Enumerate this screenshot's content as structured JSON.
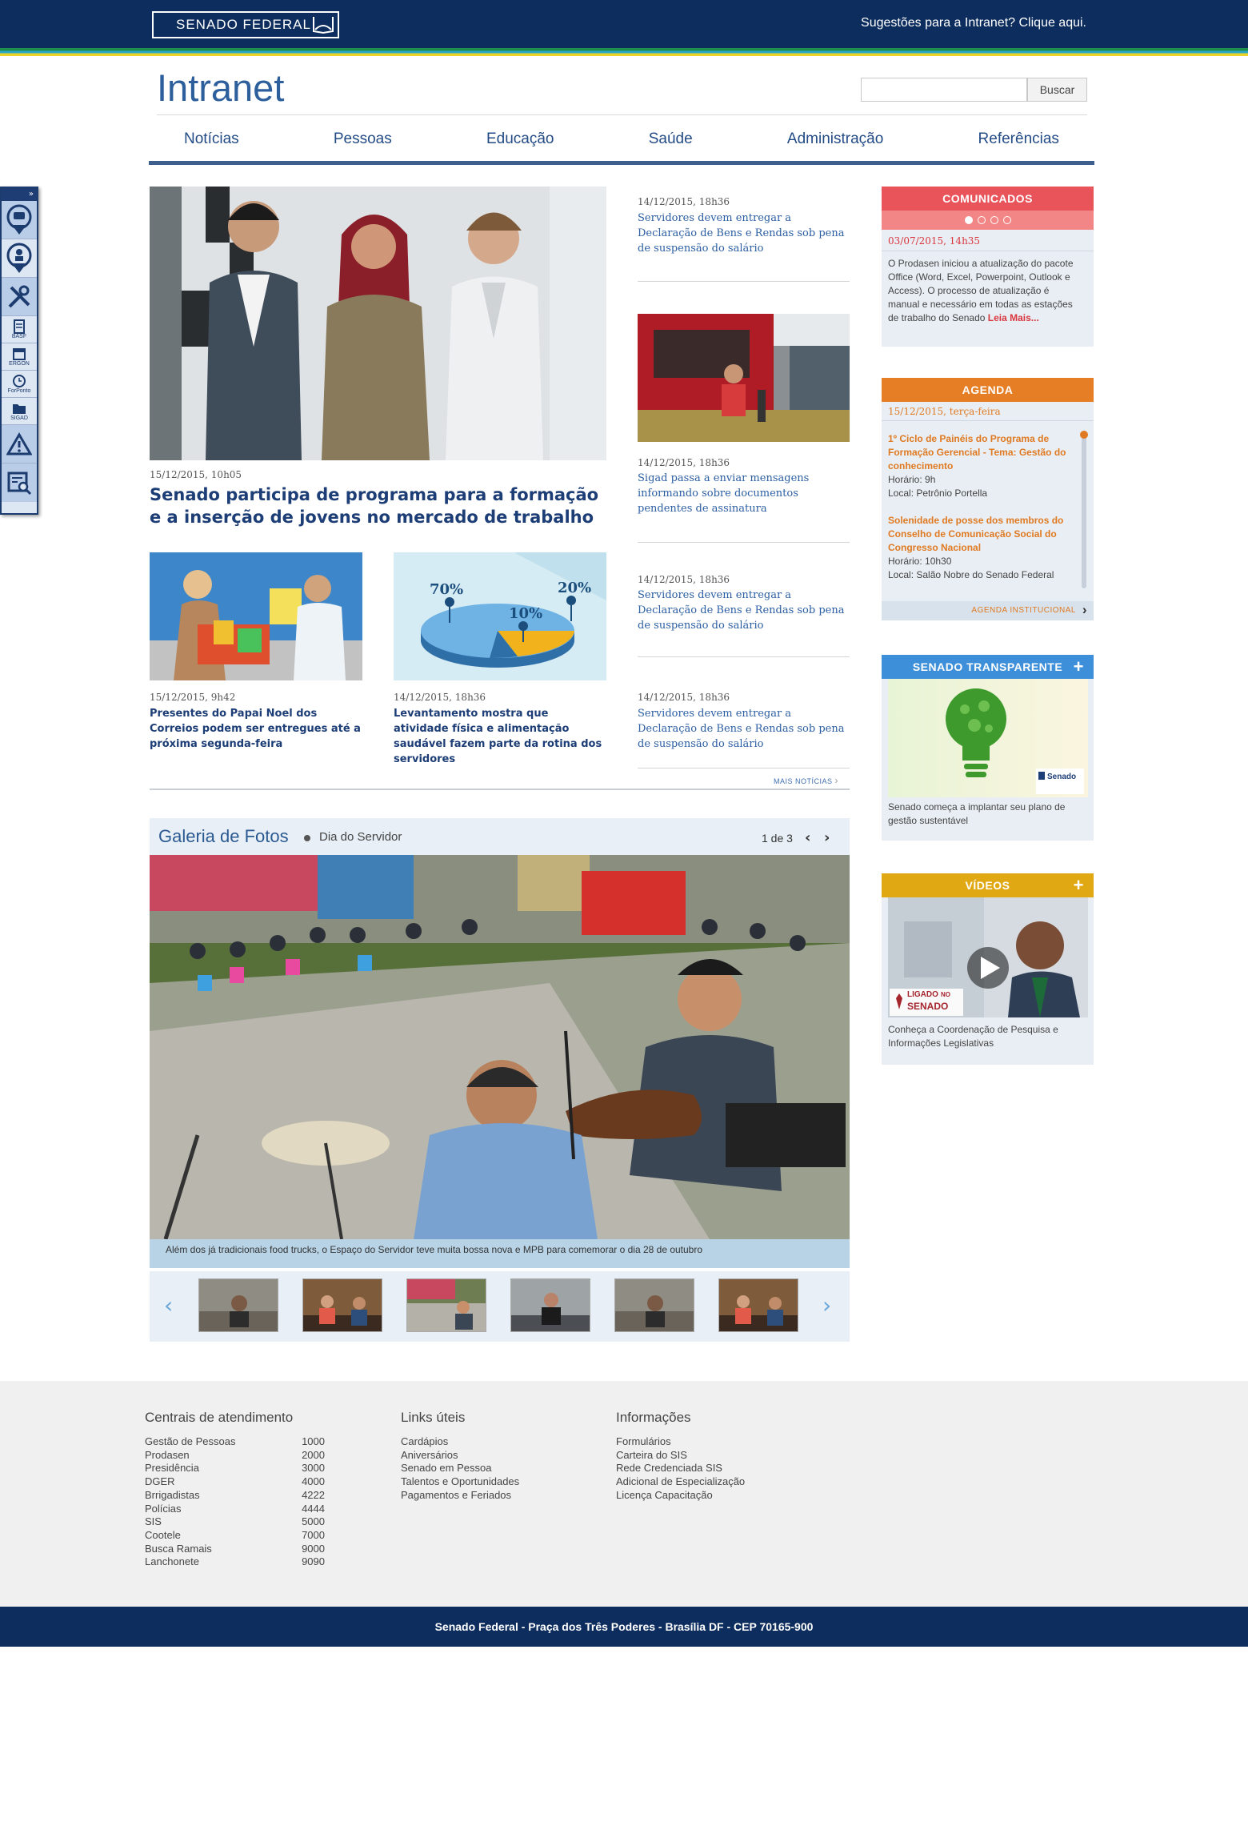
{
  "topbar": {
    "logo_text": "SENADO FEDERAL",
    "suggestion_link": "Sugestões para a Intranet? Clique aqui."
  },
  "header": {
    "title": "Intranet",
    "search_placeholder": "",
    "search_button": "Buscar"
  },
  "nav": [
    "Notícias",
    "Pessoas",
    "Educação",
    "Saúde",
    "Administração",
    "Referências"
  ],
  "tools": {
    "labels": [
      "BASF",
      "ERGON",
      "ForPonto",
      "SIGAD"
    ]
  },
  "featured": {
    "date": "15/12/2015, 10h05",
    "title": "Senado participa de programa para a formação e a inserção de jovens no mercado de trabalho"
  },
  "news_grid": [
    {
      "date": "15/12/2015, 9h42",
      "title": "Presentes do Papai Noel dos Correios podem ser entregues até a próxima segunda-feira"
    },
    {
      "date": "14/12/2015, 18h36",
      "title": "Levantamento mostra que atividade física e alimentação saudável fazem parte da rotina dos servidores"
    }
  ],
  "chart_labels": [
    "70%",
    "10%",
    "20%"
  ],
  "side_news": [
    {
      "date": "14/12/2015, 18h36",
      "title": "Servidores devem entregar a Declaração de Bens e Rendas sob pena de suspensão do salário"
    },
    {
      "date": "14/12/2015, 18h36",
      "title": "Sigad passa a enviar mensagens informando sobre documentos pendentes de assinatura"
    },
    {
      "date": "14/12/2015, 18h36",
      "title": "Servidores devem entregar a Declaração de Bens e Rendas sob pena de suspensão do salário"
    },
    {
      "date": "14/12/2015, 18h36",
      "title": "Servidores devem entregar a Declaração de Bens e Rendas sob pena de suspensão do salário"
    }
  ],
  "more_news": "MAIS NOTÍCIAS",
  "gallery": {
    "title": "Galeria de Fotos",
    "subtitle": "Dia do Servidor",
    "pager": "1 de 3",
    "caption": "Além dos já tradicionais food trucks, o Espaço do Servidor teve muita bossa nova e MPB para comemorar o dia 28 de outubro"
  },
  "comunicados": {
    "title": "COMUNICADOS",
    "date": "03/07/2015, 14h35",
    "text": "O Prodasen  iniciou a atualização do pacote Office (Word, Excel, Powerpoint, Outlook e Access). O processo de atualização é manual e necessário em todas as estações de trabalho do Senado",
    "read_more": "Leia Mais..."
  },
  "agenda": {
    "title": "AGENDA",
    "date": "15/12/2015, terça-feira",
    "events": [
      {
        "title": "1º Ciclo de Painéis do Programa de Formação Gerencial - Tema: Gestão do conhecimento",
        "time": "Horário: 9h",
        "place": "Local: Petrônio Portella"
      },
      {
        "title": "Solenidade de posse dos membros do Conselho de Comunicação Social do Congresso Nacional",
        "time": "Horário: 10h30",
        "place": "Local: Salão Nobre do Senado Federal"
      }
    ],
    "link": "AGENDA INSTITUCIONAL"
  },
  "transparente": {
    "title": "SENADO TRANSPARENTE",
    "badge": "Senado",
    "text": "Senado começa a implantar seu plano de gestão sustentável"
  },
  "videos": {
    "title": "VÍDEOS",
    "badge_line1": "LIGADO",
    "badge_line2": "NO",
    "badge_line3": "SENADO",
    "text": "Conheça a Coordenação de Pesquisa e Informações Legislativas"
  },
  "footer": {
    "col1_title": "Centrais de atendimento",
    "col1": [
      {
        "name": "Gestão de Pessoas",
        "ext": "1000"
      },
      {
        "name": "Prodasen",
        "ext": "2000"
      },
      {
        "name": "Presidência",
        "ext": "3000"
      },
      {
        "name": "DGER",
        "ext": "4000"
      },
      {
        "name": "Brrigadistas",
        "ext": "4222"
      },
      {
        "name": "Polícias",
        "ext": "4444"
      },
      {
        "name": "SIS",
        "ext": "5000"
      },
      {
        "name": "Cootele",
        "ext": "7000"
      },
      {
        "name": "Busca Ramais",
        "ext": "9000"
      },
      {
        "name": "Lanchonete",
        "ext": "9090"
      }
    ],
    "col2_title": "Links úteis",
    "col2": [
      "Cardápios",
      "Aniversários",
      "Senado em Pessoa",
      "Talentos e Oportunidades",
      "Pagamentos e Feriados"
    ],
    "col3_title": "Informações",
    "col3": [
      "Formulários",
      "Carteira do SIS",
      "Rede Credenciada SIS",
      "Adicional de Especialização",
      "Licença Capacitação"
    ],
    "address": "Senado Federal - Praça dos Três Poderes - Brasília DF - CEP 70165-900"
  }
}
